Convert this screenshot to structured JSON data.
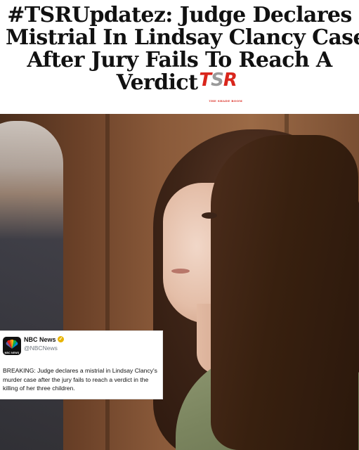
{
  "headline": {
    "line1": "#TSRUpdatez: Judge Declares",
    "line2": "Mistrial In Lindsay Clancy Case",
    "line3": "After Jury Fails To Reach A",
    "line4": "Verdict"
  },
  "logo": {
    "letters": [
      "T",
      "S",
      "R"
    ],
    "tagline": "THE SHADE ROOM",
    "colors": {
      "red": "#d9261c",
      "gray": "#9a9a9a"
    }
  },
  "tweet": {
    "account_name": "NBC News",
    "verified_badge": "✓",
    "handle": "@NBCNews",
    "logo_text": "NBC NEWS",
    "text": "BREAKING: Judge declares a mistrial in Lindsay Clancy's murder case after the jury fails to reach a verdict in the killing of her three children."
  },
  "icons": {
    "nbc_logo": "nbc-peacock-icon",
    "verified": "verified-badge-icon"
  }
}
